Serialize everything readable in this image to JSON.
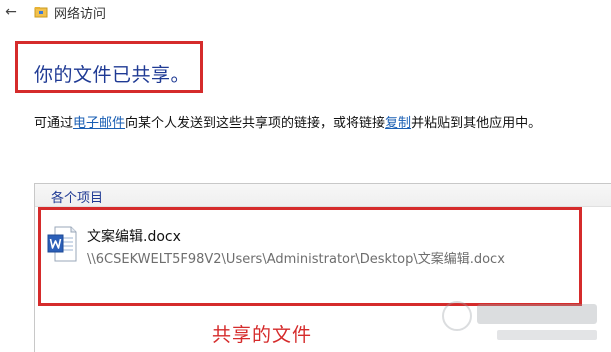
{
  "topbar": {
    "back_icon": "back-arrow-icon",
    "title": "网络访问",
    "app_icon": "network-folder-icon"
  },
  "heading": "你的文件已共享。",
  "description": {
    "part1": "可通过",
    "email_link": "电子邮件",
    "part2": "向某个人发送到这些共享项的链接，或将链接",
    "copy_link": "复制",
    "part3": "并粘贴到其他应用中。"
  },
  "group": {
    "title": "各个项目"
  },
  "file": {
    "icon": "word-document-icon",
    "name": "文案编辑.docx",
    "path": "\\\\6CSEKWELT5F98V2\\Users\\Administrator\\Desktop\\文案编辑.docx"
  },
  "annotation": {
    "caption": "共享的文件"
  },
  "colors": {
    "accent_blue": "#1f3a94",
    "link_blue": "#1a5fb4",
    "highlight_red": "#d52b2b"
  }
}
